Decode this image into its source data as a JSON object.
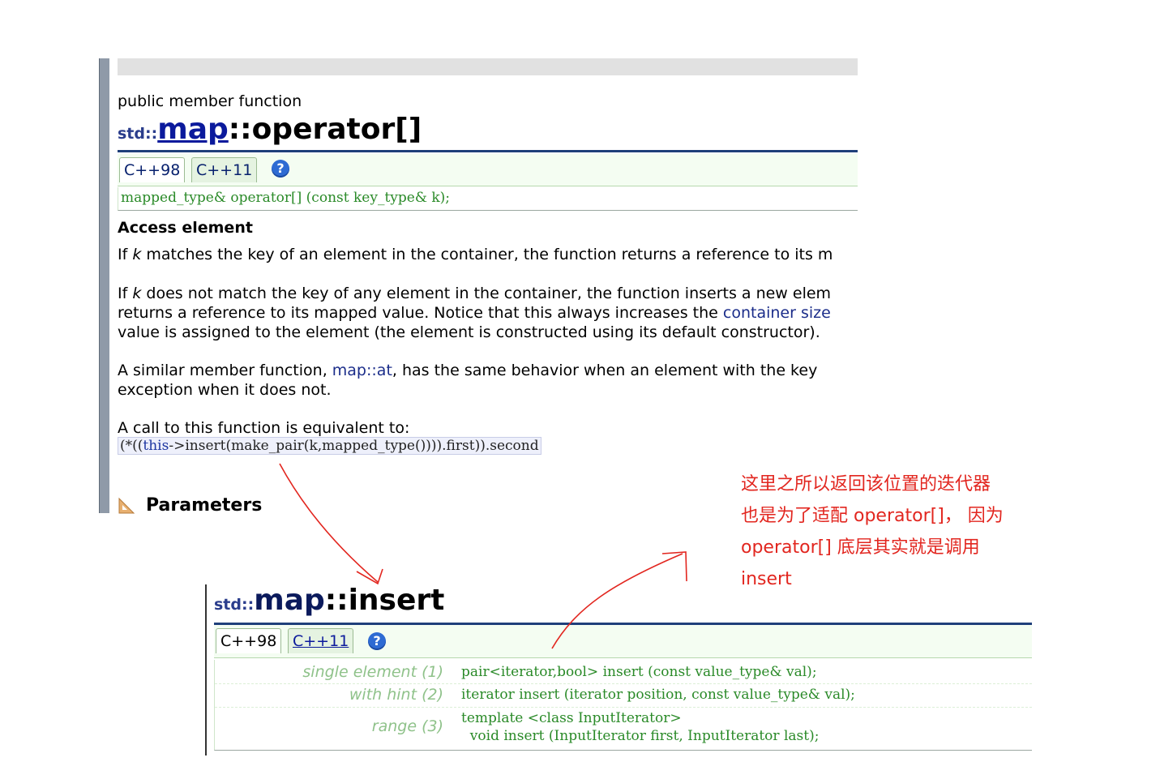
{
  "operator_page": {
    "kind": "public member function",
    "title": {
      "ns": "std::",
      "cls": "map",
      "member": "::operator[]"
    },
    "tabs": [
      "C++98",
      "C++11"
    ],
    "help": "?",
    "declaration": "mapped_type& operator[] (const key_type& k);",
    "section_heading": "Access element",
    "p1": {
      "a": "If ",
      "k": "k",
      "b": " matches the key of an element in the container, the function returns a reference to its m"
    },
    "p2": {
      "l1a": "If ",
      "k": "k",
      "l1b": " does not match the key of any element in the container, the function inserts a new elem",
      "l2a": "returns a reference to its mapped value. Notice that this always increases the ",
      "l2link": "container size",
      "l3": "value is assigned to the element (the element is constructed using its default constructor)."
    },
    "p3": {
      "l1a": "A similar member function, ",
      "l1link": "map::at",
      "l1b": ", has the same behavior when an element with the key",
      "l2": "exception when it does not."
    },
    "p4": "A call to this function is equivalent to:",
    "equiv": {
      "open": "(*((",
      "this": "this",
      "rest": "->insert(make_pair(k,mapped_type()))).first)).second"
    },
    "parameters_heading": "Parameters"
  },
  "insert_page": {
    "title": {
      "ns": "std::",
      "cls": "map",
      "member": "::insert"
    },
    "tabs": [
      "C++98",
      "C++11"
    ],
    "help": "?",
    "overloads": [
      {
        "label": "single element (1)",
        "code": "pair<iterator,bool> insert (const value_type& val);"
      },
      {
        "label": "with hint (2)",
        "code": "iterator insert (iterator position, const value_type& val);"
      },
      {
        "label": "range (3)",
        "code": "template <class InputIterator>\n  void insert (InputIterator first, InputIterator last);"
      }
    ]
  },
  "annotation": {
    "color": "#e2261f",
    "lines": [
      "这里之所以返回该位置的迭代器",
      "也是为了适配 operator[]， 因为",
      "operator[] 底层其实就是调用",
      "insert"
    ]
  }
}
